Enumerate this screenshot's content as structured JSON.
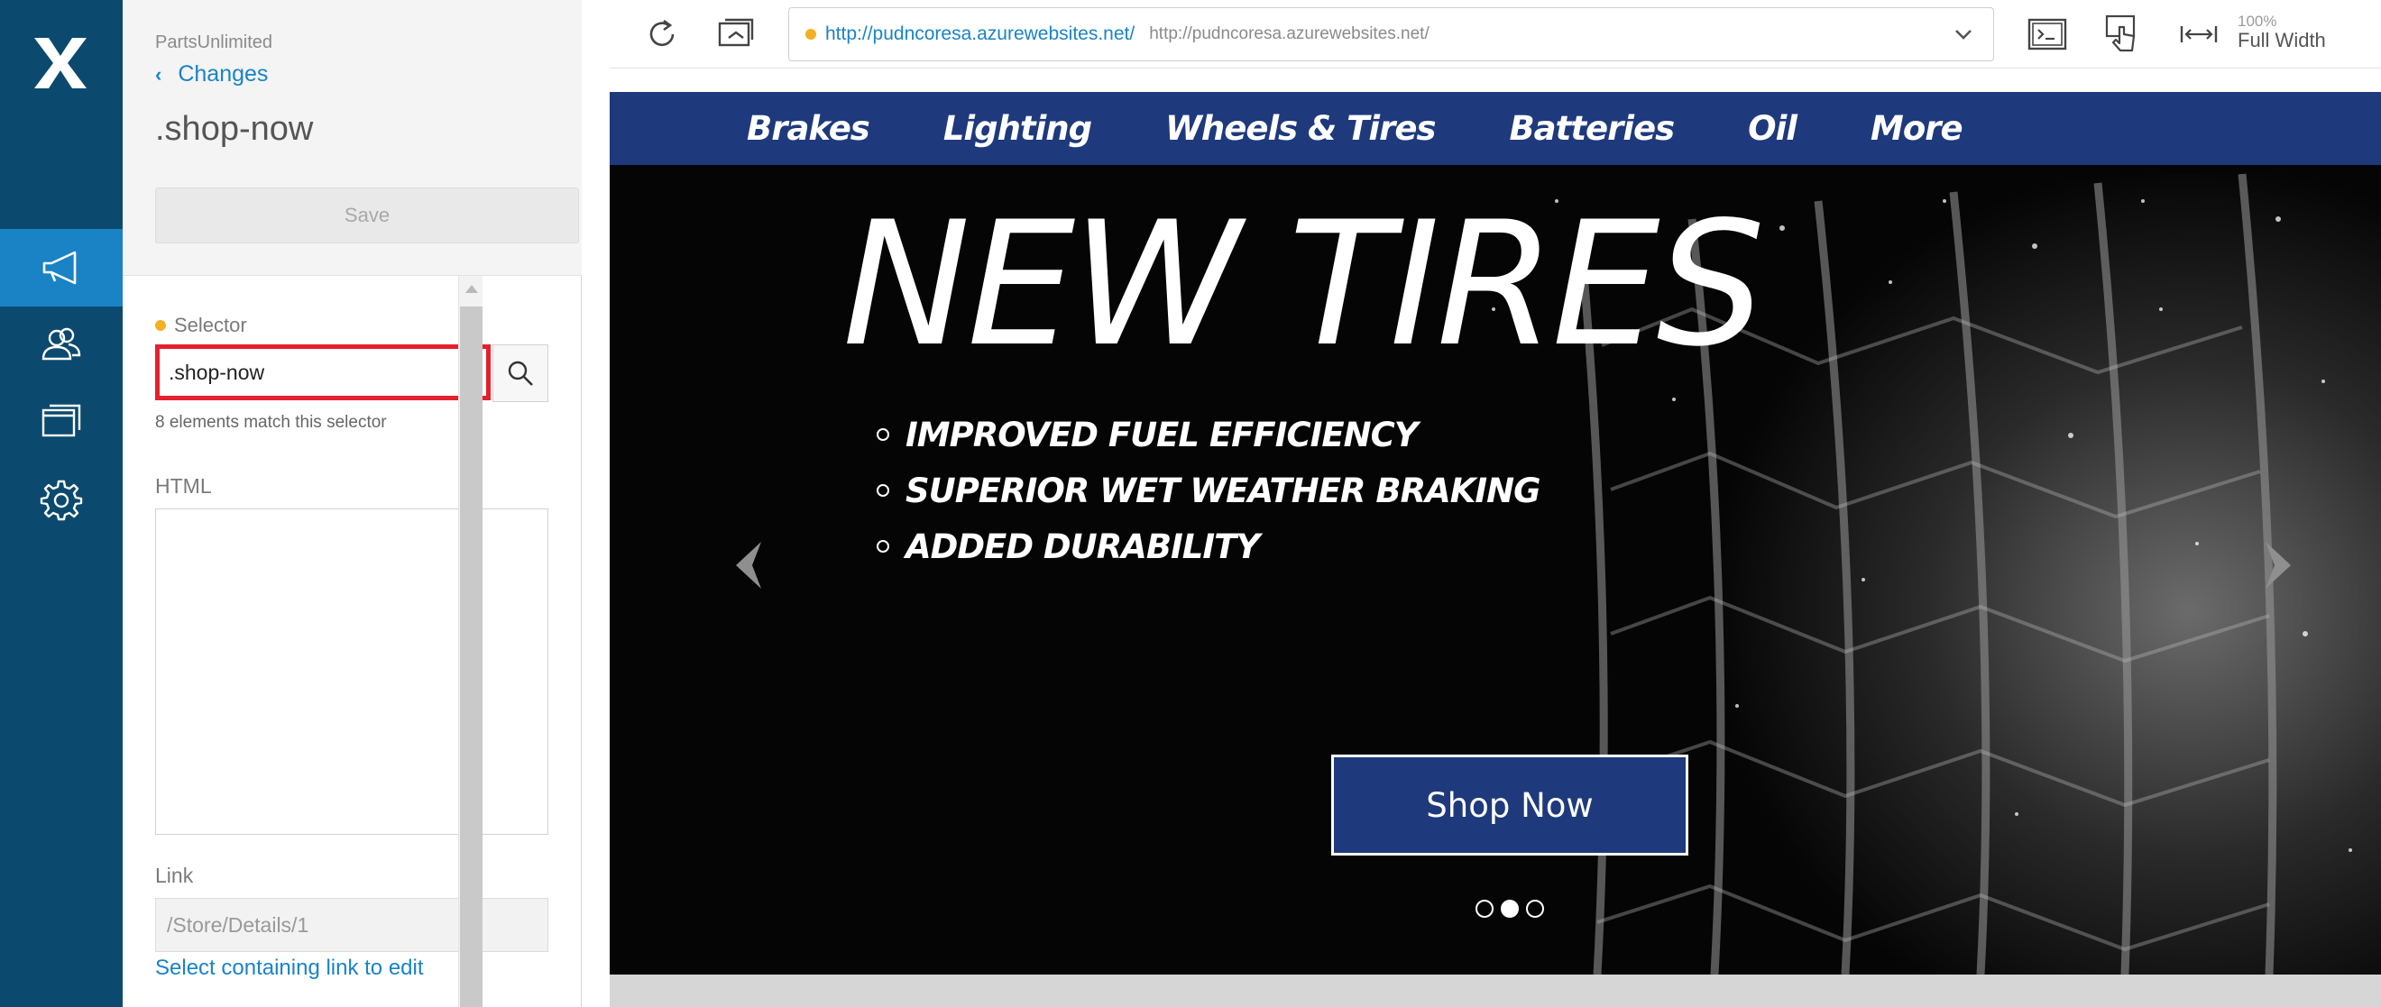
{
  "sidebar": {
    "logo_icon": "x-logo-icon",
    "items": [
      {
        "icon": "megaphone-icon",
        "active": true
      },
      {
        "icon": "users-icon",
        "active": false
      },
      {
        "icon": "cards-icon",
        "active": false
      },
      {
        "icon": "gear-icon",
        "active": false
      }
    ]
  },
  "panel": {
    "project": "PartsUnlimited",
    "back_label": "Changes",
    "title": ".shop-now",
    "save_label": "Save",
    "selector_label": "Selector",
    "selector_value": ".shop-now",
    "selector_hint": "8 elements match this selector",
    "html_label": "HTML",
    "html_value": "",
    "link_label": "Link",
    "link_placeholder": "/Store/Details/1",
    "link_action": "Select containing link to edit"
  },
  "toolbar": {
    "url_main": "http://pudncoresa.azurewebsites.net/",
    "url_sub": "http://pudncoresa.azurewebsites.net/",
    "zoom_pct": "100%",
    "zoom_mode": "Full Width"
  },
  "site": {
    "nav": [
      "Brakes",
      "Lighting",
      "Wheels & Tires",
      "Batteries",
      "Oil",
      "More"
    ],
    "hero_title": "NEW TIRES",
    "bullets": [
      "IMPROVED FUEL EFFICIENCY",
      "SUPERIOR WET WEATHER BRAKING",
      "ADDED DURABILITY"
    ],
    "shop_label": "Shop Now",
    "carousel_active": 2,
    "carousel_count": 3
  },
  "colors": {
    "rail": "#0b4a6e",
    "rail_active": "#1a83c6",
    "link": "#1a83c6",
    "highlight": "#e4212d",
    "site_nav": "#1e3a7c"
  }
}
